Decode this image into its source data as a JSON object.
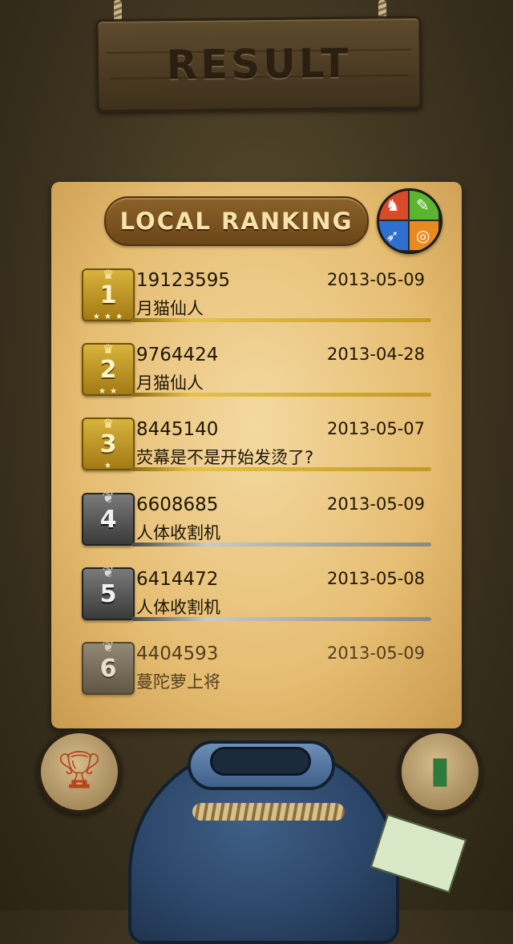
{
  "header": {
    "title": "RESULT"
  },
  "panel": {
    "title": "LOCAL RANKING"
  },
  "game_center": {
    "icon": "game-center-icon"
  },
  "rankings": [
    {
      "rank": "1",
      "tier": "gold",
      "score": "19123595",
      "date": "2013-05-09",
      "name": "月猫仙人"
    },
    {
      "rank": "2",
      "tier": "gold",
      "score": "9764424",
      "date": "2013-04-28",
      "name": "月猫仙人"
    },
    {
      "rank": "3",
      "tier": "gold",
      "score": "8445140",
      "date": "2013-05-07",
      "name": "荧幕是不是开始发烫了?"
    },
    {
      "rank": "4",
      "tier": "silver",
      "score": "6608685",
      "date": "2013-05-09",
      "name": "人体收割机"
    },
    {
      "rank": "5",
      "tier": "silver",
      "score": "6414472",
      "date": "2013-05-08",
      "name": "人体收割机"
    },
    {
      "rank": "6",
      "tier": "silver",
      "score": "4404593",
      "date": "2013-05-09",
      "name": "蔓陀萝上将"
    }
  ],
  "bottom": {
    "left_icon": "trophy-icon",
    "right_icon": "book-icon"
  },
  "colors": {
    "panel": "#e6bd72",
    "gold": "#c29a24",
    "silver": "#888888",
    "jar": "#2a4466"
  }
}
